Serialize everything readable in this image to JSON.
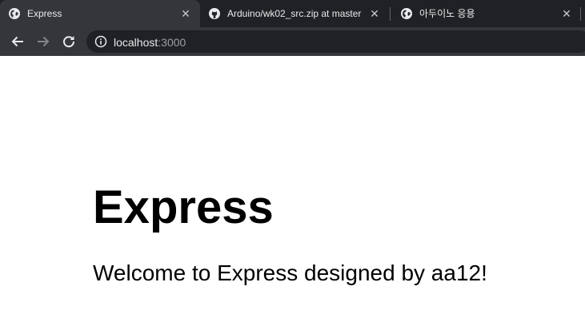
{
  "browser": {
    "tabs": [
      {
        "title": "Express",
        "icon": "globe-icon",
        "active": true
      },
      {
        "title": "Arduino/wk02_src.zip at master",
        "icon": "github-icon",
        "active": false
      },
      {
        "title": "아두이노 응용",
        "icon": "globe-icon",
        "active": false
      }
    ],
    "close_glyph": "✕",
    "address_bar": {
      "host": "localhost",
      "port": ":3000"
    }
  },
  "page": {
    "heading": "Express",
    "text": "Welcome to Express designed by aa12!"
  },
  "colors": {
    "tabstrip_bg": "#202124",
    "toolbar_bg": "#35363a",
    "omnibox_bg": "#202124",
    "tab_text": "#e8eaed",
    "url_dim": "#9aa0a6",
    "page_bg": "#ffffff"
  }
}
